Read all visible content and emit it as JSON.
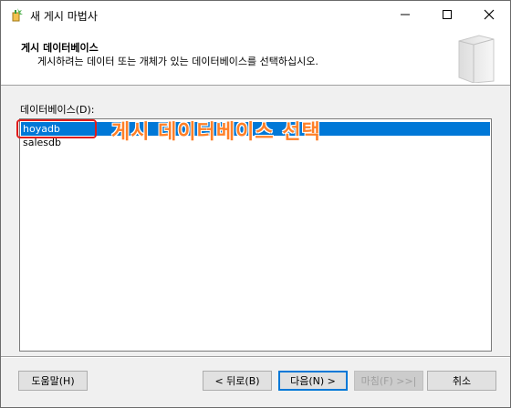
{
  "window": {
    "title": "새 게시 마법사",
    "icon": "wizard-icon"
  },
  "header": {
    "title": "게시 데이터베이스",
    "description": "게시하려는 데이터 또는 개체가 있는 데이터베이스를 선택하십시오."
  },
  "databases": {
    "label": "데이터베이스(D):",
    "items": [
      {
        "name": "hoyadb",
        "selected": true
      },
      {
        "name": "salesdb",
        "selected": false
      }
    ]
  },
  "annotation": {
    "text": "게시 데이터베이스 선택",
    "color": "#ff7f27",
    "box_color": "#e01b1b"
  },
  "buttons": {
    "help": "도움말(H)",
    "back": "< 뒤로(B)",
    "next": "다음(N) >",
    "finish": "마침(F) >>|",
    "cancel": "취소"
  },
  "colors": {
    "selection": "#0078d7"
  }
}
